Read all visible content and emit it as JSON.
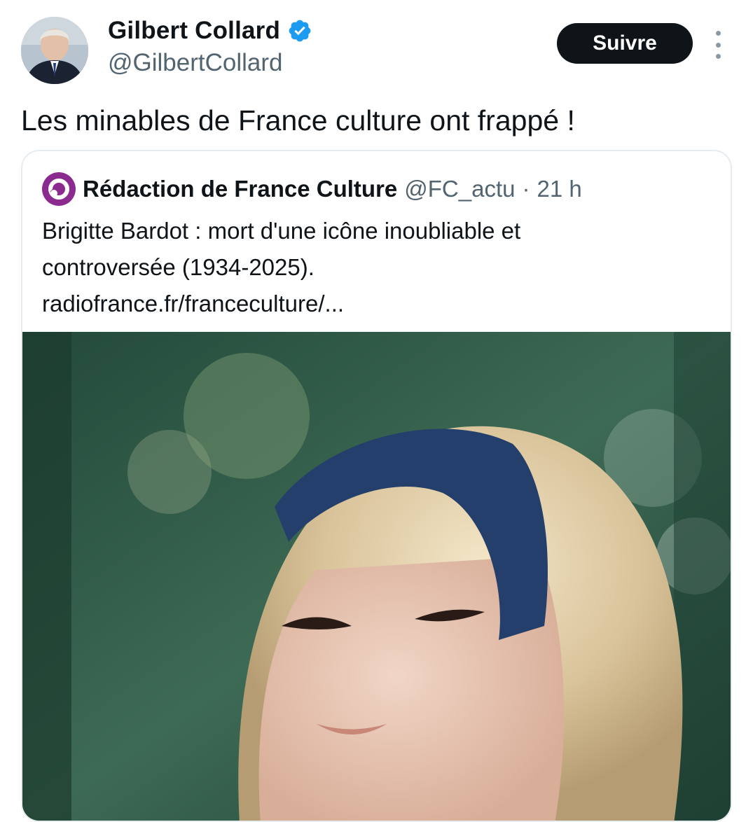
{
  "author": {
    "display_name": "Gilbert Collard",
    "handle": "@GilbertCollard",
    "verified": true
  },
  "actions": {
    "follow_label": "Suivre"
  },
  "tweet": {
    "text": "Les minables de France culture ont frappé !"
  },
  "quoted": {
    "name": "Rédaction de France Culture",
    "handle": "@FC_actu",
    "separator": "·",
    "time": "21 h",
    "lines": [
      "Brigitte Bardot : mort d'une icône inoubliable et",
      "controversée (1934-2025).",
      "radiofrance.fr/franceculture/..."
    ]
  },
  "colors": {
    "text": "#0f1419",
    "secondary": "#536471",
    "verified_blue": "#1d9bf0",
    "button_bg": "#0f1419",
    "card_border": "#e6ecf0",
    "france_culture_purple": "#8b2a8f"
  },
  "icons": {
    "verified": "verified-badge-icon",
    "more": "more-vertical-icon",
    "quoted_avatar": "france-culture-logo-icon"
  }
}
